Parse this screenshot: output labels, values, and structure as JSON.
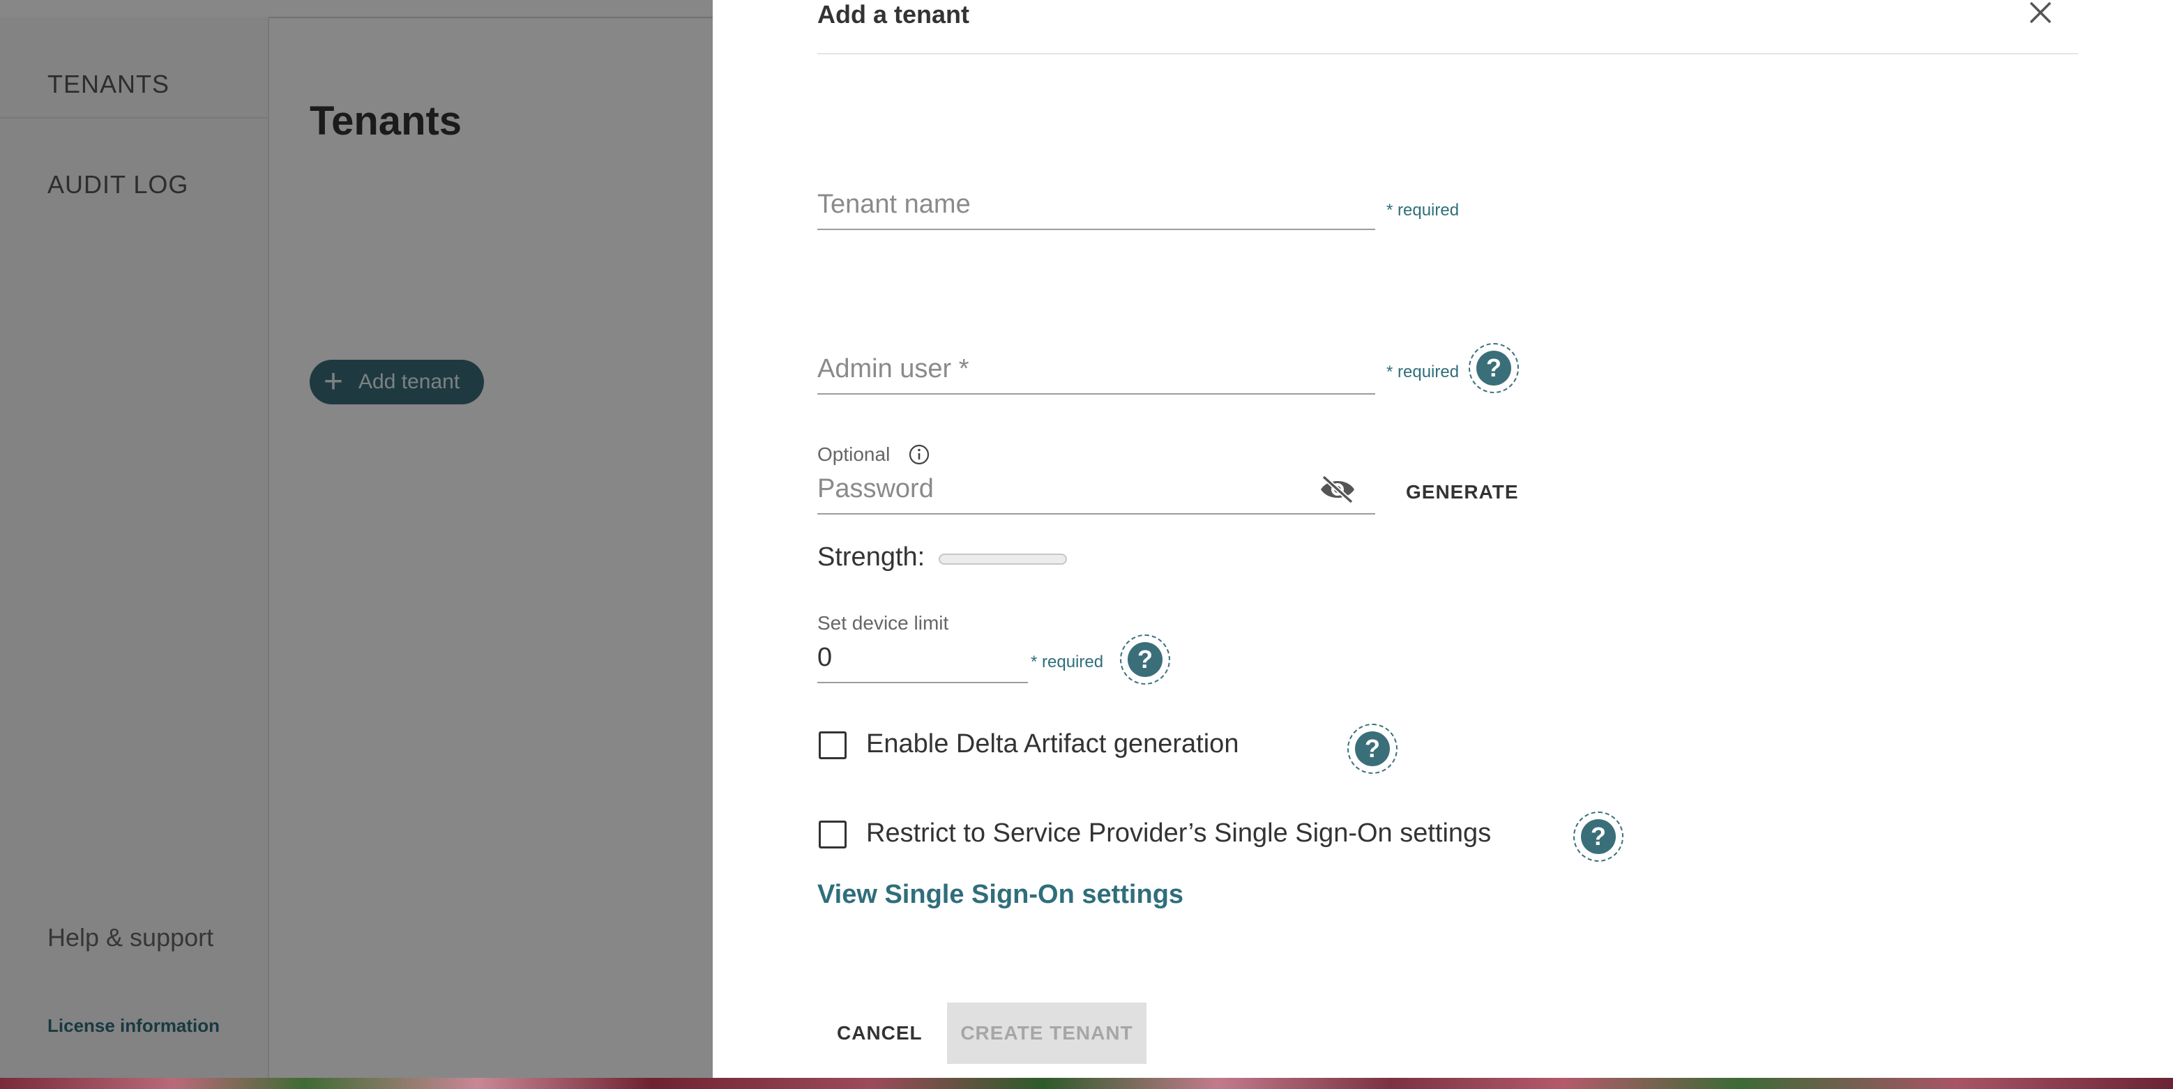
{
  "sidebar": {
    "items": [
      {
        "label": "TENANTS"
      },
      {
        "label": "AUDIT LOG"
      }
    ],
    "help_label": "Help & support",
    "license_label": "License information"
  },
  "main": {
    "title": "Tenants",
    "add_button_label": "Add tenant"
  },
  "dialog": {
    "title": "Add a tenant",
    "tenant_name": {
      "placeholder": "Tenant name",
      "required": "* required"
    },
    "admin_user": {
      "placeholder": "Admin user *",
      "required": "* required"
    },
    "password": {
      "optional_label": "Optional",
      "placeholder": "Password",
      "generate_label": "GENERATE"
    },
    "strength": {
      "label": "Strength:",
      "level": 0
    },
    "device_limit": {
      "label": "Set device limit",
      "value": "0",
      "required": "* required"
    },
    "delta_checkbox": {
      "label": "Enable Delta Artifact generation",
      "checked": false
    },
    "sso_checkbox": {
      "label": "Restrict to Service Provider’s Single Sign-On settings",
      "checked": false
    },
    "sso_link": "View Single Sign-On settings",
    "cancel_label": "CANCEL",
    "create_label": "CREATE TENANT"
  },
  "colors": {
    "accent": "#3a6f7a",
    "link": "#2f6e7b",
    "disabled_bg": "#e0e0e0",
    "disabled_text": "#a6a6a6"
  },
  "icons": {
    "close": "close-icon",
    "info": "info-icon",
    "visibility": "eye-off-icon",
    "help": "help-icon",
    "add": "plus-icon"
  }
}
